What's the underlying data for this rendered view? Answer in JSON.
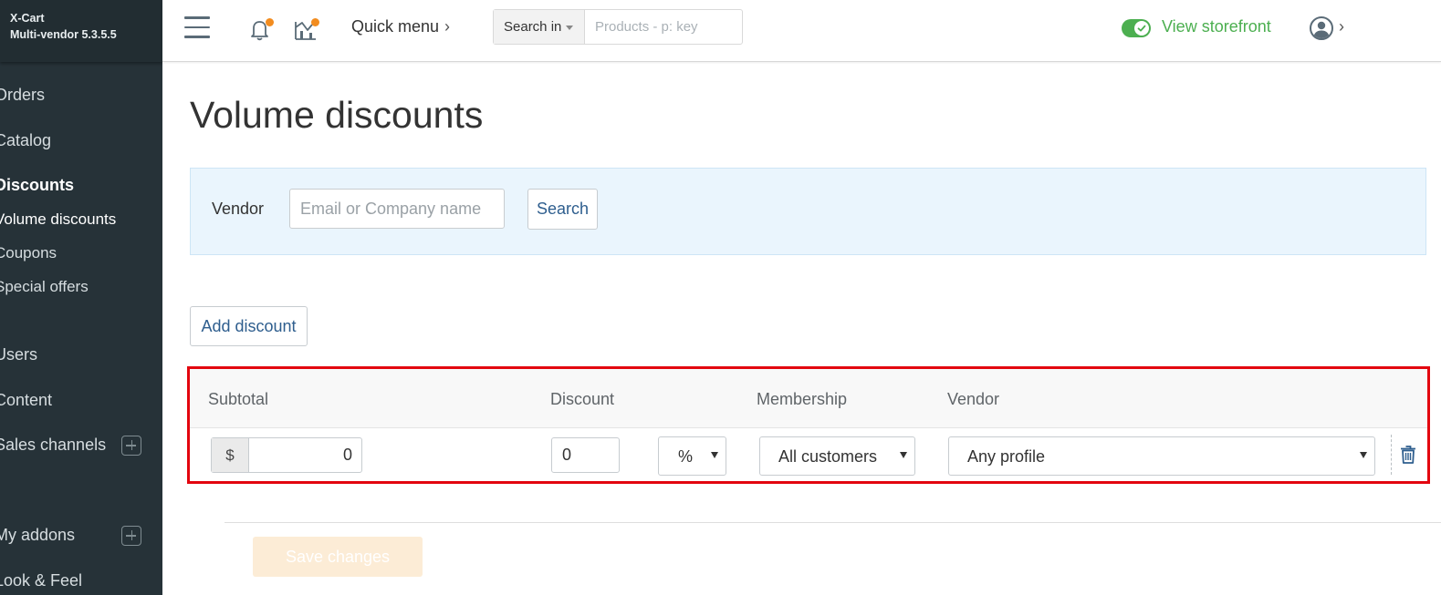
{
  "brand": {
    "name": "X-Cart",
    "edition": "Multi-vendor 5.3.5.5"
  },
  "sidebar": {
    "items": [
      {
        "label": "Orders"
      },
      {
        "label": "Catalog"
      },
      {
        "label": "Discounts",
        "active": true,
        "children": [
          {
            "label": "Volume discounts",
            "current": true
          },
          {
            "label": "Coupons"
          },
          {
            "label": "Special offers"
          }
        ]
      },
      {
        "label": "Users"
      },
      {
        "label": "Content"
      },
      {
        "label": "Sales channels"
      },
      {
        "label": "My addons"
      },
      {
        "label": "Look & Feel"
      }
    ]
  },
  "header": {
    "quick_menu": "Quick menu",
    "search": {
      "scope_label": "Search in",
      "placeholder": "Products - p: key"
    },
    "storefront": {
      "label": "View storefront",
      "enabled": true
    }
  },
  "page": {
    "title": "Volume discounts",
    "filter": {
      "label": "Vendor",
      "placeholder": "Email or Company name",
      "button": "Search"
    },
    "add_button": "Add discount"
  },
  "table": {
    "columns": [
      "Subtotal",
      "Discount",
      "Membership",
      "Vendor"
    ],
    "rows": [
      {
        "currency": "$",
        "subtotal": "0",
        "discount": "0",
        "discount_type": "%",
        "membership": "All customers",
        "vendor": "Any profile"
      }
    ]
  },
  "footer": {
    "save_button": "Save changes"
  },
  "colors": {
    "sidebar_bg": "#263238",
    "accent_green": "#4caf50",
    "notify_orange": "#f28c1f",
    "highlight_red": "#e3060f",
    "filter_bg": "#eaf5fd",
    "link_blue": "#2e5e8e"
  }
}
